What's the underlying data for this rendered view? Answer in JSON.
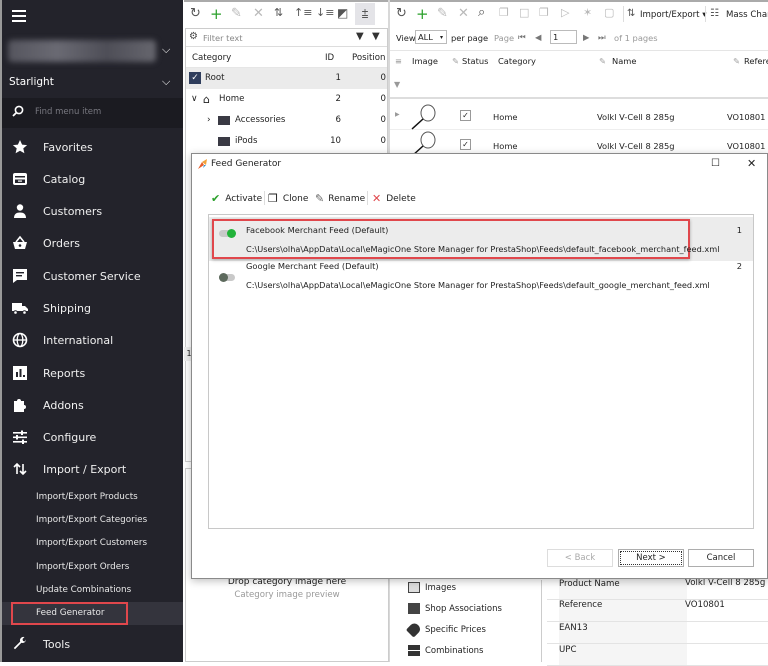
{
  "sidebar": {
    "store_name": "",
    "shop": "Starlight",
    "search_placeholder": "Find menu item",
    "items": [
      {
        "label": "Favorites",
        "icon": "star-icon"
      },
      {
        "label": "Catalog",
        "icon": "catalog-icon"
      },
      {
        "label": "Customers",
        "icon": "user-icon"
      },
      {
        "label": "Orders",
        "icon": "basket-icon"
      },
      {
        "label": "Customer Service",
        "icon": "message-icon"
      },
      {
        "label": "Shipping",
        "icon": "truck-icon"
      },
      {
        "label": "International",
        "icon": "globe-icon"
      },
      {
        "label": "Reports",
        "icon": "chart-icon"
      },
      {
        "label": "Addons",
        "icon": "puzzle-icon"
      },
      {
        "label": "Configure",
        "icon": "sliders-icon"
      },
      {
        "label": "Import / Export",
        "icon": "import-export-icon"
      }
    ],
    "sub_items": [
      {
        "label": "Import/Export Products"
      },
      {
        "label": "Import/Export Categories"
      },
      {
        "label": "Import/Export Customers"
      },
      {
        "label": "Import/Export Orders"
      },
      {
        "label": "Update Combinations"
      },
      {
        "label": "Feed Generator",
        "active": true
      }
    ],
    "tools": {
      "label": "Tools",
      "icon": "wrench-icon"
    }
  },
  "category_panel": {
    "filter_placeholder": "Filter text",
    "columns": [
      "Category",
      "ID",
      "Position"
    ],
    "rows": [
      {
        "name": "Root",
        "id": "1",
        "position": "0"
      },
      {
        "name": "Home",
        "id": "2",
        "position": "0"
      },
      {
        "name": "Accessories",
        "id": "6",
        "position": "0"
      },
      {
        "name": "iPods",
        "id": "10",
        "position": "0"
      }
    ],
    "drop_text": "Drop category image here",
    "preview_text": "Category image preview",
    "side_number": "1"
  },
  "product_panel": {
    "toolbar": {
      "import_export": "Import/Export",
      "mass_changes": "Mass Char"
    },
    "pager": {
      "view_label": "View",
      "view_value": "ALL",
      "per_page": "per page",
      "page_label": "Page",
      "page_value": "1",
      "of_pages": "of 1 pages"
    },
    "columns": [
      "Image",
      "Status",
      "Category",
      "Name",
      "Refere"
    ],
    "rows": [
      {
        "category": "Home",
        "name": "Volkl V-Cell 8 285g",
        "reference": "VO10801",
        "checked": true,
        "strikethrough": false
      },
      {
        "category": "Home",
        "name": "Volkl V-Cell 8 285g",
        "reference": "VO10801",
        "checked": true,
        "strikethrough": true
      }
    ]
  },
  "detail_panel": {
    "nav": [
      {
        "label": "Images",
        "icon": "image-icon"
      },
      {
        "label": "Shop Associations",
        "icon": "shop-icon"
      },
      {
        "label": "Specific Prices",
        "icon": "tag-icon"
      },
      {
        "label": "Combinations",
        "icon": "grid-icon"
      }
    ],
    "properties": [
      {
        "key": "Product Name",
        "value": "Volkl V-Cell 8 285g"
      },
      {
        "key": "Reference",
        "value": "VO10801"
      },
      {
        "key": "EAN13",
        "value": ""
      },
      {
        "key": "UPC",
        "value": ""
      }
    ]
  },
  "dialog": {
    "title": "Feed Generator",
    "toolbar": {
      "activate": "Activate",
      "clone": "Clone",
      "rename": "Rename",
      "delete": "Delete"
    },
    "feeds": [
      {
        "name": "Facebook Merchant Feed (Default)",
        "path": "C:\\Users\\olha\\AppData\\Local\\eMagicOne Store Manager for PrestaShop\\Feeds\\default_facebook_merchant_feed.xml",
        "number": "1",
        "active": true,
        "selected": true
      },
      {
        "name": "Google Merchant Feed (Default)",
        "path": "C:\\Users\\olha\\AppData\\Local\\eMagicOne Store Manager for PrestaShop\\Feeds\\default_google_merchant_feed.xml",
        "number": "2",
        "active": false,
        "selected": false
      }
    ],
    "buttons": {
      "back": "< Back",
      "next": "Next >",
      "cancel": "Cancel"
    }
  },
  "colors": {
    "sidebar_bg": "#23232b",
    "highlight": "#e0474c",
    "toggle_on": "#22b33a",
    "toggle_off": "#5d6a5d"
  }
}
